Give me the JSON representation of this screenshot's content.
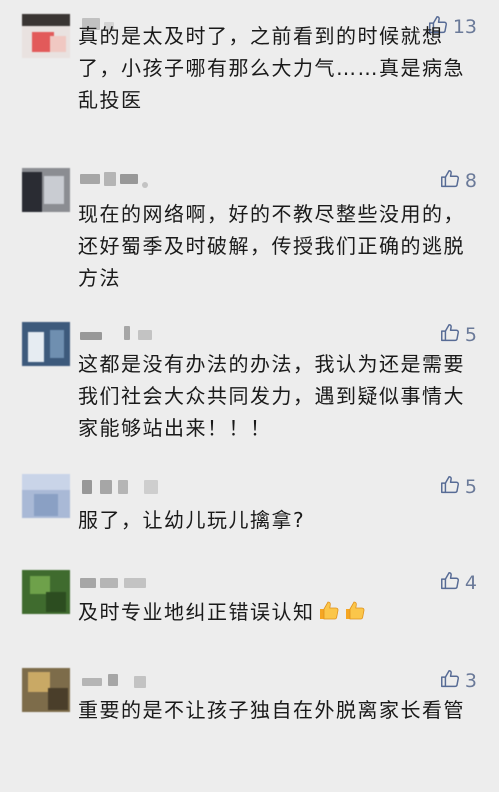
{
  "comments": [
    {
      "likes": "13",
      "text": "真的是太及时了，之前看到的时候就想了，小孩子哪有那么大力气……真是病急乱投医"
    },
    {
      "likes": "8",
      "text": "现在的网络啊，好的不教尽整些没用的，还好蜀季及时破解，传授我们正确的逃脱方法"
    },
    {
      "likes": "5",
      "text": "这都是没有办法的办法，我认为还是需要我们社会大众共同发力，遇到疑似事情大家能够站出来！！！"
    },
    {
      "likes": "5",
      "text": "服了，让幼儿玩儿擒拿?"
    },
    {
      "likes": "4",
      "text": "及时专业地纠正错误认知"
    },
    {
      "likes": "3",
      "text": "重要的是不让孩子独自在外脱离家长看管"
    }
  ],
  "icons": {
    "like": "thumbs-up-outline-icon",
    "emoji": "thumbs-up-emoji-icon"
  },
  "colors": {
    "background": "#ededed",
    "like_icon": "#576b95",
    "emoji": "#f5a623"
  }
}
